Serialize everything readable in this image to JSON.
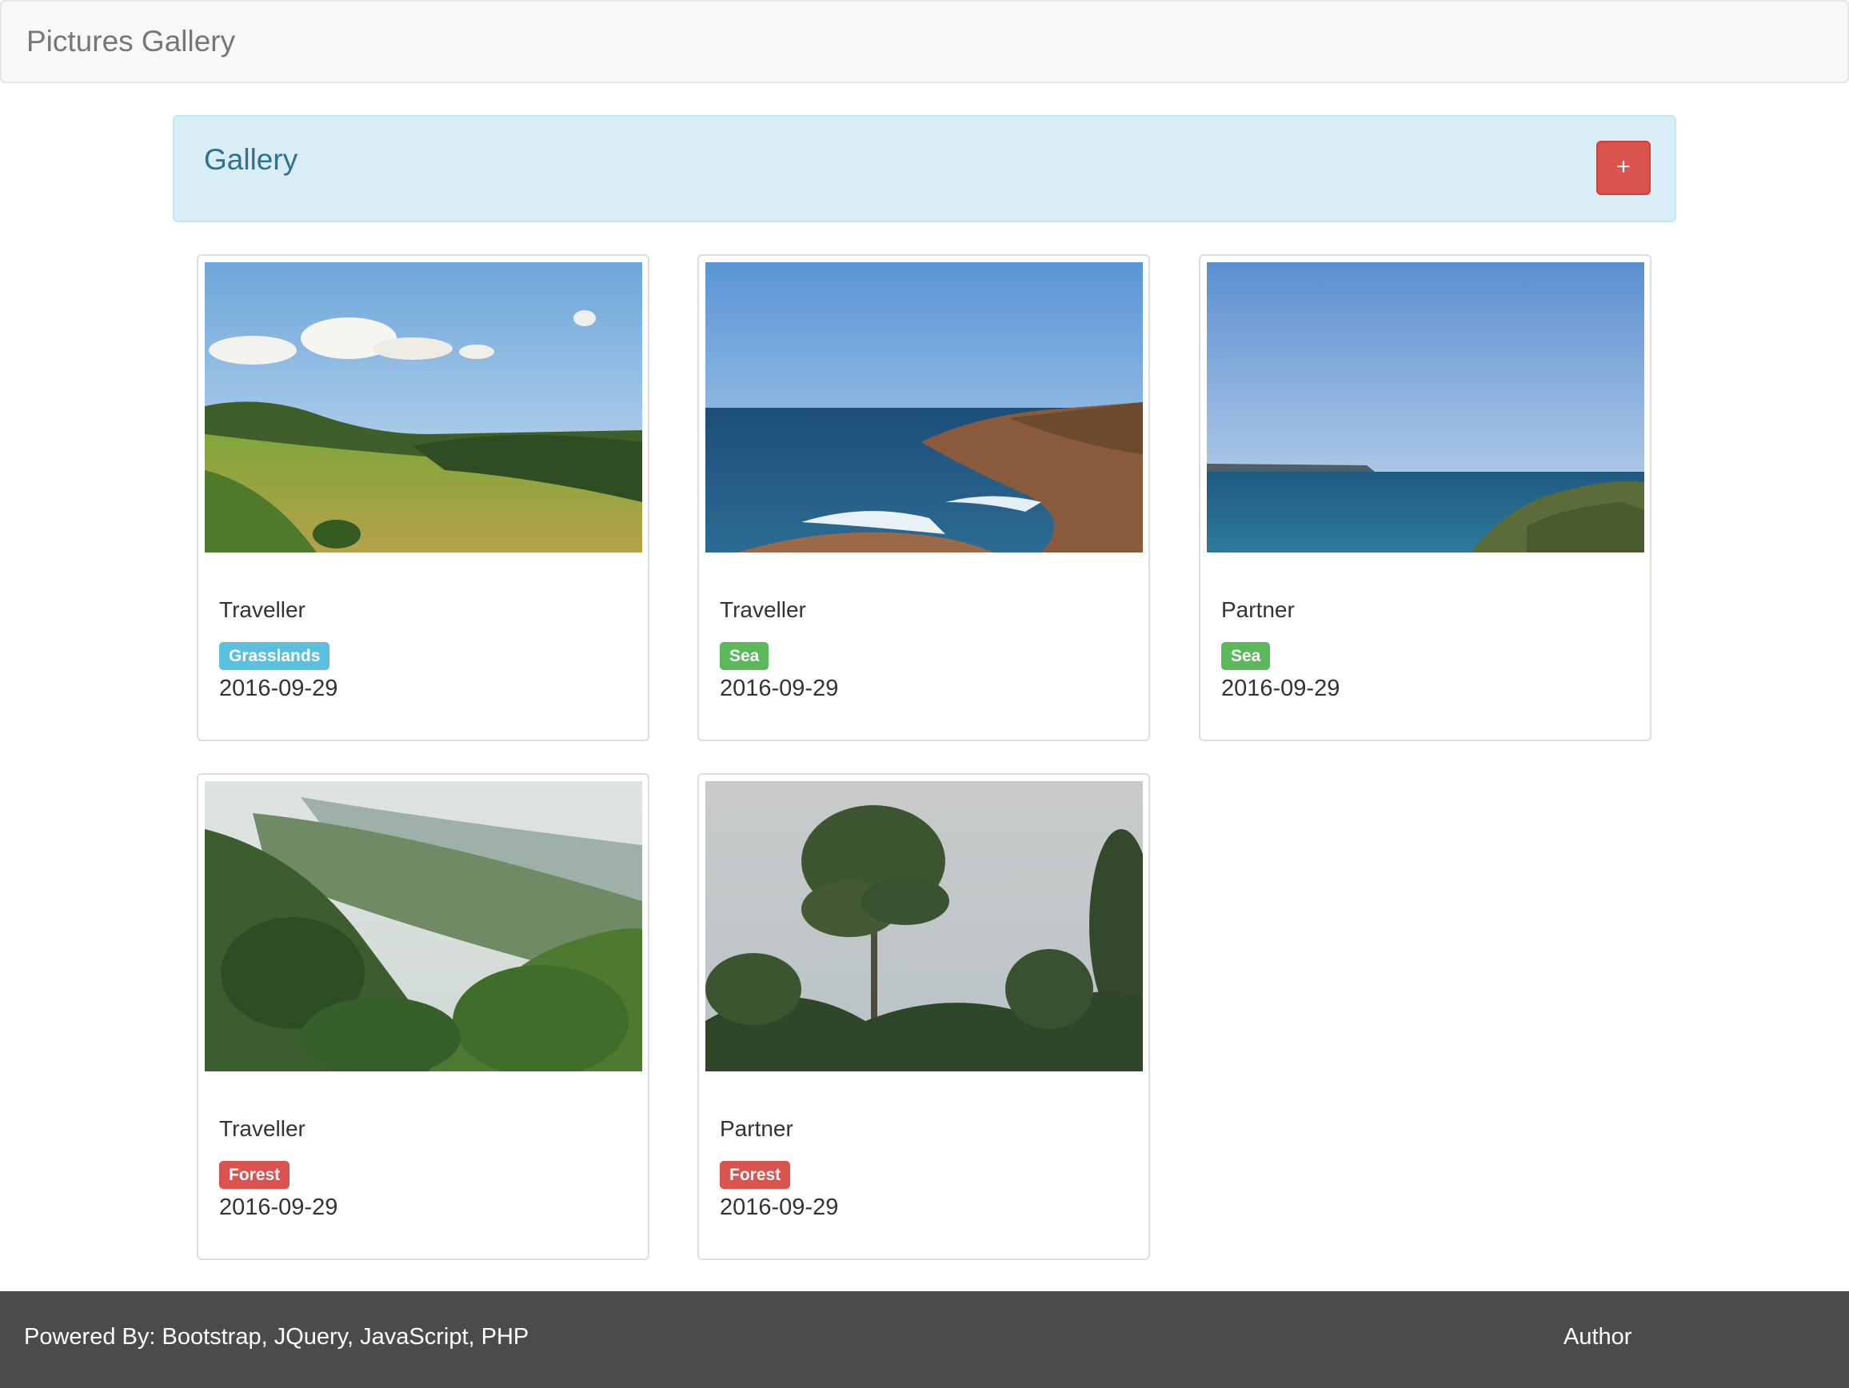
{
  "navbar": {
    "brand": "Pictures Gallery"
  },
  "panel": {
    "title": "Gallery",
    "add_label": "+"
  },
  "colors": {
    "tag_grasslands": "#5bc0de",
    "tag_sea": "#5cb85c",
    "tag_forest": "#d9534f",
    "add_button": "#d9534f",
    "footer_bg": "#4b4b4b"
  },
  "cards": [
    {
      "name": "Traveller",
      "tag": "Grasslands",
      "date": "2016-09-29",
      "photo": "grassland-hills-photo"
    },
    {
      "name": "Traveller",
      "tag": "Sea",
      "date": "2016-09-29",
      "photo": "rocky-coast-photo"
    },
    {
      "name": "Partner",
      "tag": "Sea",
      "date": "2016-09-29",
      "photo": "ocean-horizon-photo"
    },
    {
      "name": "Traveller",
      "tag": "Forest",
      "date": "2016-09-29",
      "photo": "forest-valley-photo"
    },
    {
      "name": "Partner",
      "tag": "Forest",
      "date": "2016-09-29",
      "photo": "tall-tree-photo"
    }
  ],
  "footer": {
    "powered": "Powered By: Bootstrap, JQuery, JavaScript, PHP",
    "author": "Author"
  }
}
